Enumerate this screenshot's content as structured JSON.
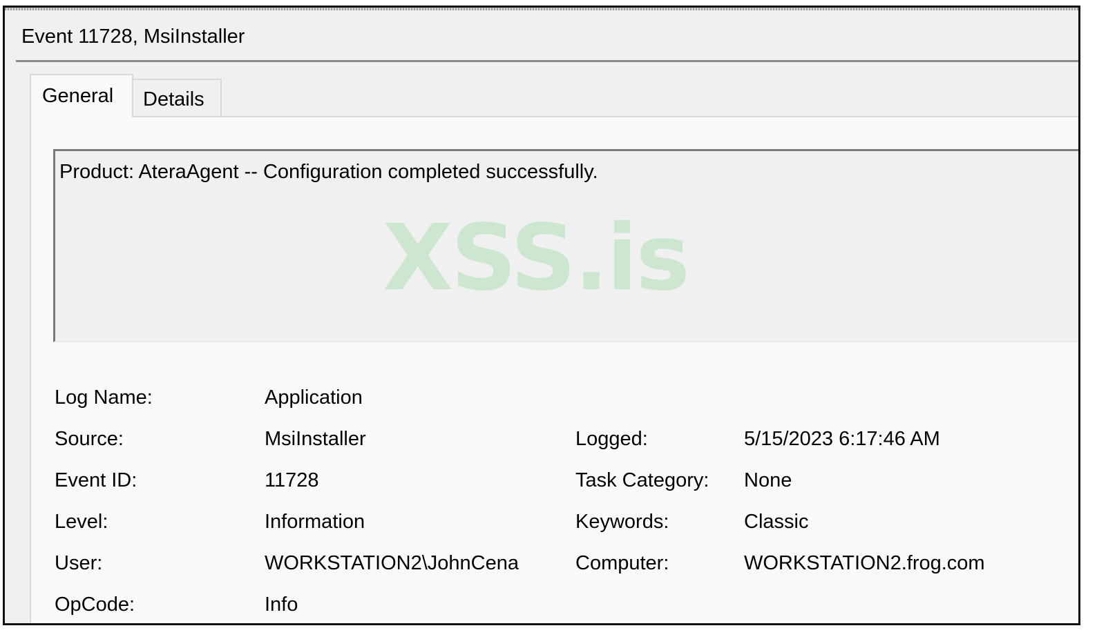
{
  "window": {
    "title": "Event 11728, MsiInstaller"
  },
  "tabs": [
    {
      "label": "General",
      "selected": true
    },
    {
      "label": "Details",
      "selected": false
    }
  ],
  "description": "Product: AteraAgent -- Configuration completed successfully.",
  "watermark": "XSS.is",
  "fields": {
    "log_name": {
      "label": "Log Name:",
      "value": "Application"
    },
    "source": {
      "label": "Source:",
      "value": "MsiInstaller"
    },
    "logged": {
      "label": "Logged:",
      "value": "5/15/2023 6:17:46 AM"
    },
    "event_id": {
      "label": "Event ID:",
      "value": "11728"
    },
    "task_category": {
      "label": "Task Category:",
      "value": "None"
    },
    "level": {
      "label": "Level:",
      "value": "Information"
    },
    "keywords": {
      "label": "Keywords:",
      "value": "Classic"
    },
    "user": {
      "label": "User:",
      "value": "WORKSTATION2\\JohnCena"
    },
    "computer": {
      "label": "Computer:",
      "value": "WORKSTATION2.frog.com"
    },
    "opcode": {
      "label": "OpCode:",
      "value": "Info"
    }
  },
  "colors": {
    "window_bg": "#f0f0f0",
    "panel_bg": "#f9f9f9",
    "watermark": "#c9e6cd"
  }
}
